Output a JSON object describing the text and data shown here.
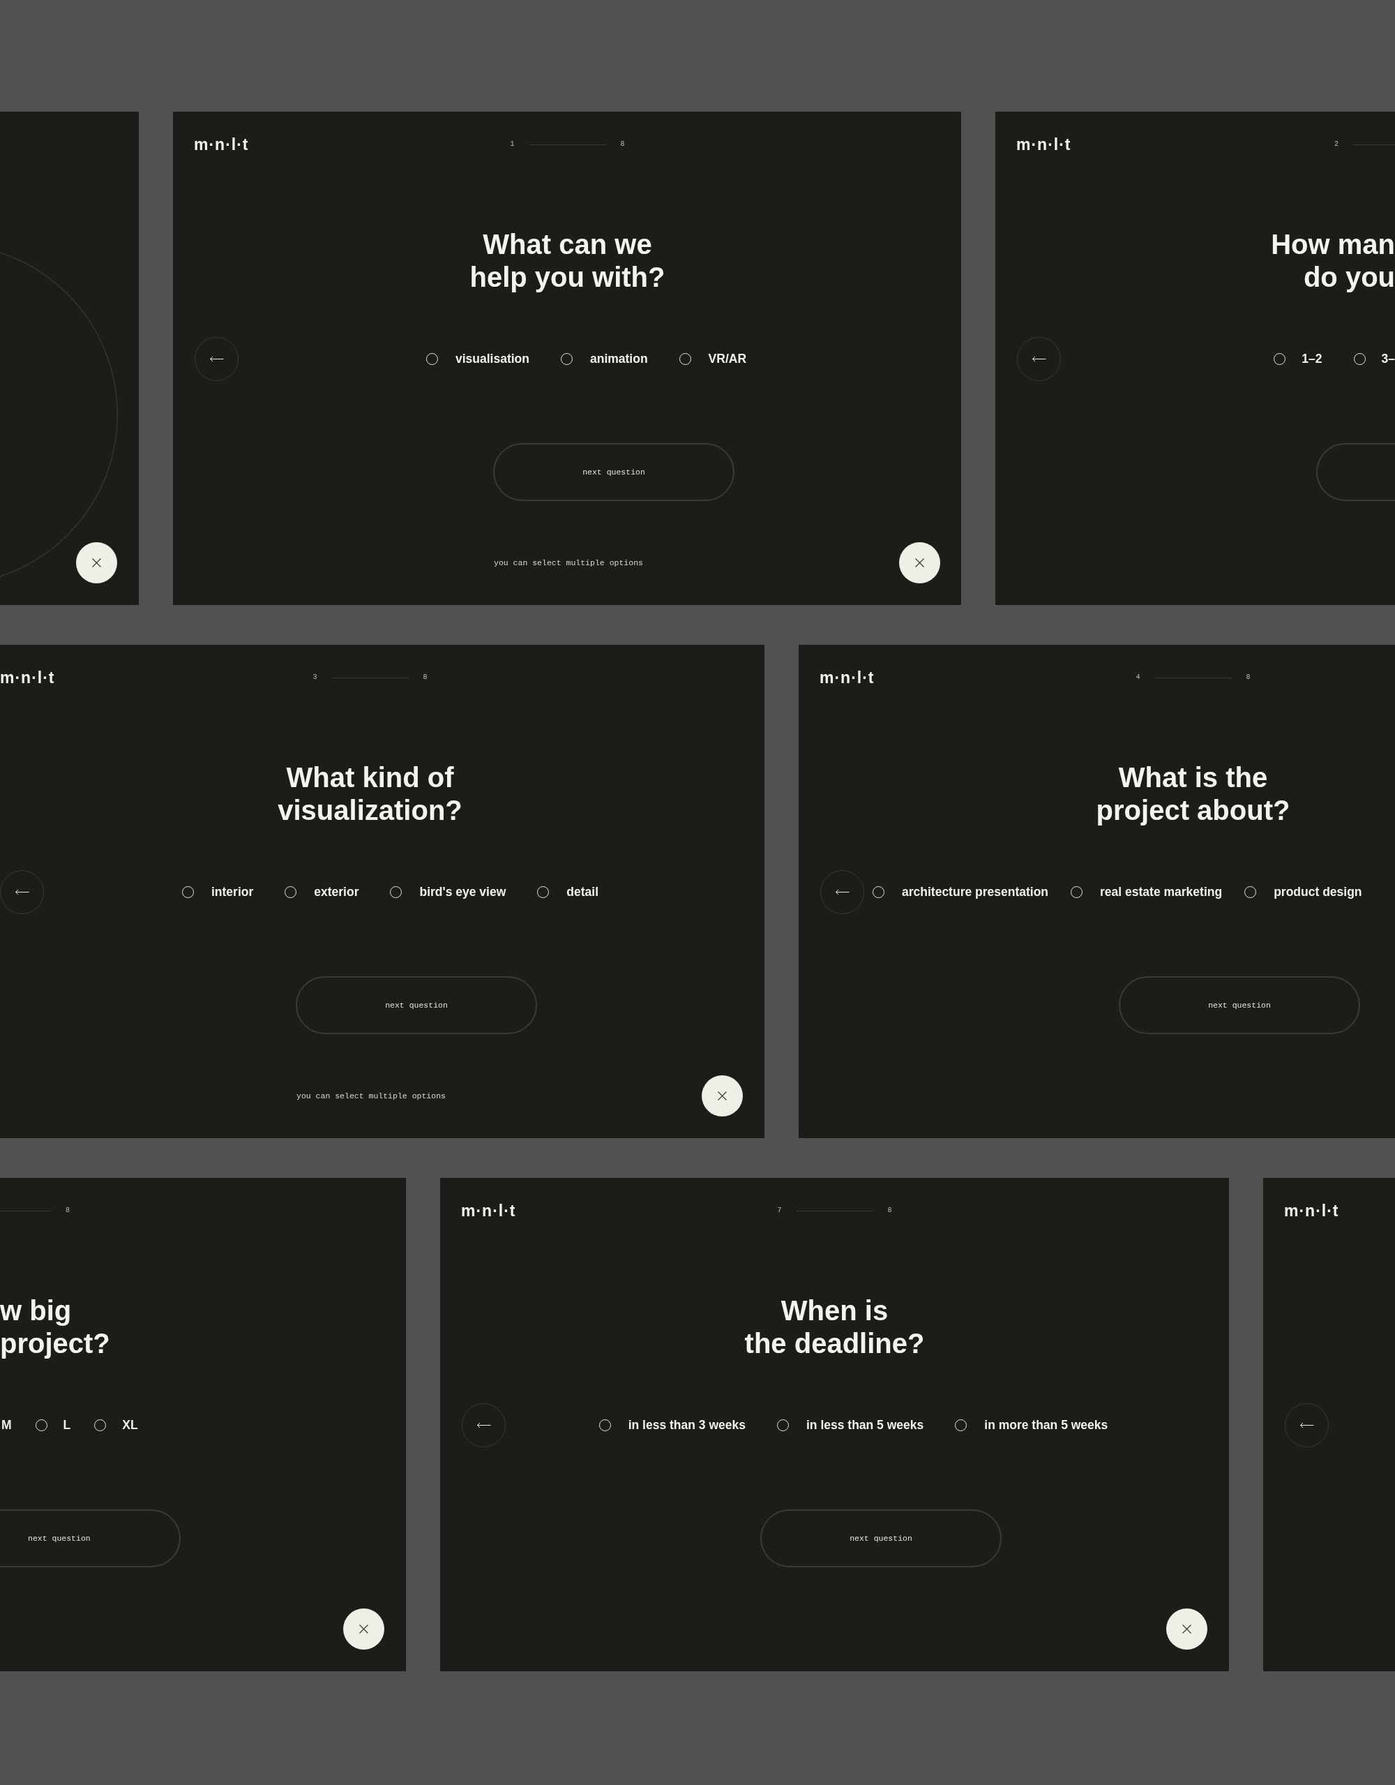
{
  "rows": [
    {
      "cards": [
        {
          "kind": "intro",
          "close_button": true
        },
        {
          "kind": "question",
          "logo": "m·n·l·t",
          "progress": {
            "current": "1",
            "total": "8"
          },
          "title": [
            "What can we",
            "help you with?"
          ],
          "back_button": true,
          "options": [
            {
              "label": "visualisation",
              "selected": false
            },
            {
              "label": "animation",
              "selected": false
            },
            {
              "label": "VR/AR",
              "selected": false
            }
          ],
          "next_button": true,
          "next_label": "next question",
          "note": "you can select multiple options",
          "close_button": true
        },
        {
          "kind": "question",
          "logo": "m·n·l·t",
          "progress": {
            "current": "2"
          },
          "title": [
            "How man",
            "do you"
          ],
          "back_button": true,
          "options": [
            {
              "label": "1–2",
              "selected": false
            },
            {
              "label": "3–",
              "selected": false
            }
          ],
          "next_button": true
        }
      ]
    },
    {
      "cards": [
        {
          "kind": "question",
          "logo": "m·n·l·t",
          "progress": {
            "current": "3",
            "total": "8"
          },
          "title": [
            "What kind of",
            "visualization?"
          ],
          "back_button": true,
          "options": [
            {
              "label": "interior",
              "selected": false
            },
            {
              "label": "exterior",
              "selected": false
            },
            {
              "label": "bird's eye view",
              "selected": false
            },
            {
              "label": "detail",
              "selected": false
            }
          ],
          "next_button": true,
          "next_label": "next question",
          "note": "you can select multiple options",
          "close_button": true
        },
        {
          "kind": "question",
          "logo": "m·n·l·t",
          "progress": {
            "current": "4",
            "total": "8"
          },
          "title": [
            "What is the",
            "project about?"
          ],
          "back_button": true,
          "options": [
            {
              "label": "architecture presentation",
              "selected": false
            },
            {
              "label": "real estate marketing",
              "selected": false
            },
            {
              "label": "product design",
              "selected": false
            }
          ],
          "next_button": true,
          "next_label": "next question"
        }
      ]
    },
    {
      "cards": [
        {
          "kind": "question",
          "progress": {
            "total": "8"
          },
          "title": [
            "w big",
            "project?"
          ],
          "options": [
            {
              "label": "M"
            },
            {
              "label": "L",
              "selected": false
            },
            {
              "label": "XL",
              "selected": false
            }
          ],
          "next_button": true,
          "next_label": "next question",
          "close_button": true
        },
        {
          "kind": "question",
          "logo": "m·n·l·t",
          "progress": {
            "current": "7",
            "total": "8"
          },
          "title": [
            "When is",
            "the deadline?"
          ],
          "back_button": true,
          "options": [
            {
              "label": "in less than 3 weeks",
              "selected": false
            },
            {
              "label": "in less than 5 weeks",
              "selected": false
            },
            {
              "label": "in more than 5 weeks",
              "selected": false
            }
          ],
          "next_button": true,
          "next_label": "next question",
          "close_button": true
        },
        {
          "kind": "question",
          "logo": "m·n·l·t",
          "back_button": true
        }
      ]
    }
  ]
}
